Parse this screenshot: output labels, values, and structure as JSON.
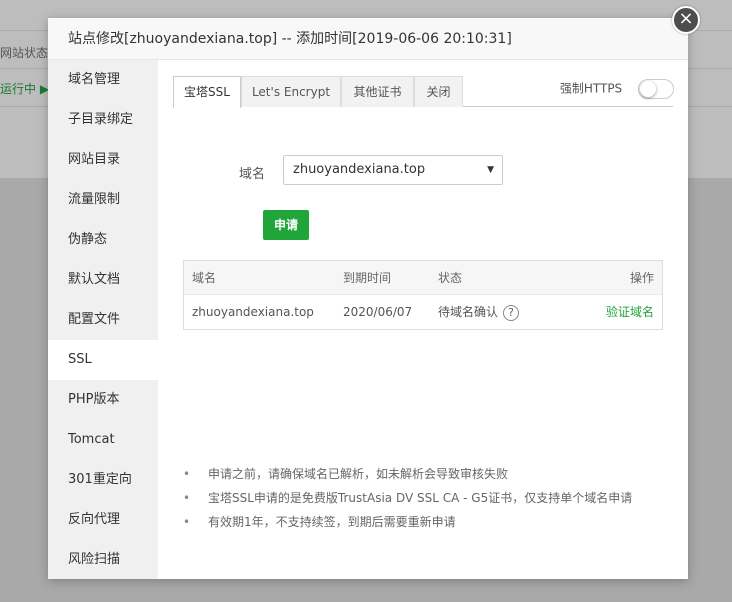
{
  "background": {
    "status_label": "网站状态",
    "running_label": "运行中 ▶"
  },
  "modal": {
    "title": "站点修改[zhuoyandexiana.top] -- 添加时间[2019-06-06 20:10:31]",
    "close_glyph": "×"
  },
  "sidebar": {
    "items": [
      {
        "label": "域名管理"
      },
      {
        "label": "子目录绑定"
      },
      {
        "label": "网站目录"
      },
      {
        "label": "流量限制"
      },
      {
        "label": "伪静态"
      },
      {
        "label": "默认文档"
      },
      {
        "label": "配置文件"
      },
      {
        "label": "SSL"
      },
      {
        "label": "PHP版本"
      },
      {
        "label": "Tomcat"
      },
      {
        "label": "301重定向"
      },
      {
        "label": "反向代理"
      },
      {
        "label": "风险扫描"
      }
    ],
    "active_index": 7
  },
  "tabs": [
    {
      "label": "宝塔SSL"
    },
    {
      "label": "Let's Encrypt"
    },
    {
      "label": "其他证书"
    },
    {
      "label": "关闭"
    }
  ],
  "force_https": {
    "label": "强制HTTPS",
    "enabled": false
  },
  "form": {
    "domain_label": "域名",
    "domain_value": "zhuoyandexiana.top",
    "arrow": "▼",
    "apply_label": "申请"
  },
  "table": {
    "headers": {
      "domain": "域名",
      "expire": "到期时间",
      "status": "状态",
      "action": "操作"
    },
    "rows": [
      {
        "domain": "zhuoyandexiana.top",
        "expire": "2020/06/07",
        "status": "待域名确认",
        "help": "?",
        "action": "验证域名"
      }
    ]
  },
  "notes": [
    "申请之前，请确保域名已解析，如未解析会导致审核失败",
    "宝塔SSL申请的是免费版TrustAsia DV SSL CA - G5证书，仅支持单个域名申请",
    "有效期1年，不支持续签，到期后需要重新申请"
  ],
  "bullet": "•",
  "colors": {
    "accent": "#20a53a",
    "sidebar_bg": "#f0f0f0",
    "title_bg": "#f8f8f8"
  }
}
